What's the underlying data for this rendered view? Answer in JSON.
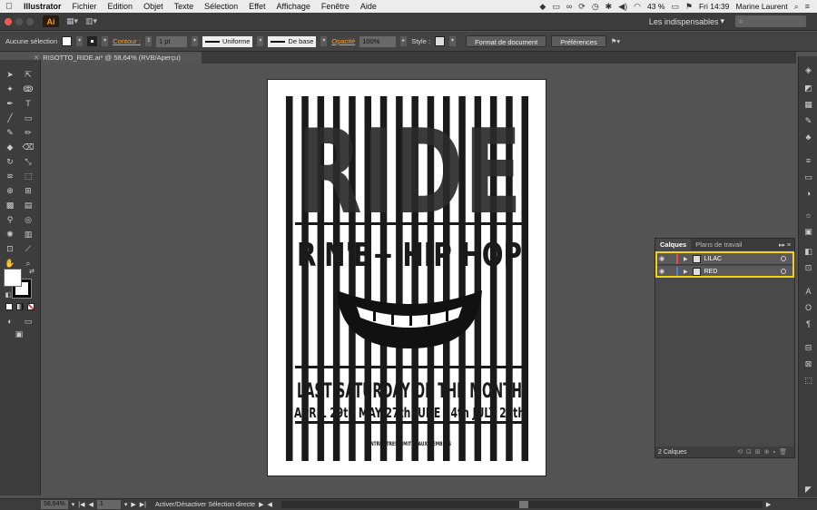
{
  "menubar": {
    "app": "Illustrator",
    "items": [
      "Fichier",
      "Edition",
      "Objet",
      "Texte",
      "Sélection",
      "Effet",
      "Affichage",
      "Fenêtre",
      "Aide"
    ],
    "battery": "43 %",
    "clock": "Fri 14:39",
    "user": "Marine Laurent"
  },
  "appbar": {
    "logo": "Ai",
    "workspace": "Les indispensables"
  },
  "control": {
    "selection": "Aucune sélection",
    "contour_label": "Contour :",
    "stroke_weight": "1 pt",
    "profile": "Uniforme",
    "brush": "De base",
    "opacity_label": "Opacité",
    "opacity": "100%",
    "style_label": "Style :",
    "doc_setup": "Format de document",
    "prefs": "Préférences"
  },
  "document": {
    "tab_title": "RISOTTO_RIDE.ai* @ 58,64% (RVB/Aperçu)"
  },
  "poster": {
    "title": "RIDE",
    "subtitle": "R'N'B+ HIP HOP",
    "event": "LAST SATURDAY OF THE MONTH",
    "dates": "APRIL 29th    MAY 27th    JUNE 24th    JULY 29th",
    "footer": "ENTRÉE TRES LIMITEE AUX MEMBRES"
  },
  "layers_panel": {
    "tab_active": "Calques",
    "tab_other": "Plans de travail",
    "rows": [
      {
        "name": "LILAC",
        "color": "#e1534f"
      },
      {
        "name": "RED",
        "color": "#4c7de0"
      }
    ],
    "count": "2 Calques"
  },
  "status": {
    "zoom": "58,64%",
    "page": "1",
    "tool": "Activer/Désactiver Sélection directe"
  }
}
